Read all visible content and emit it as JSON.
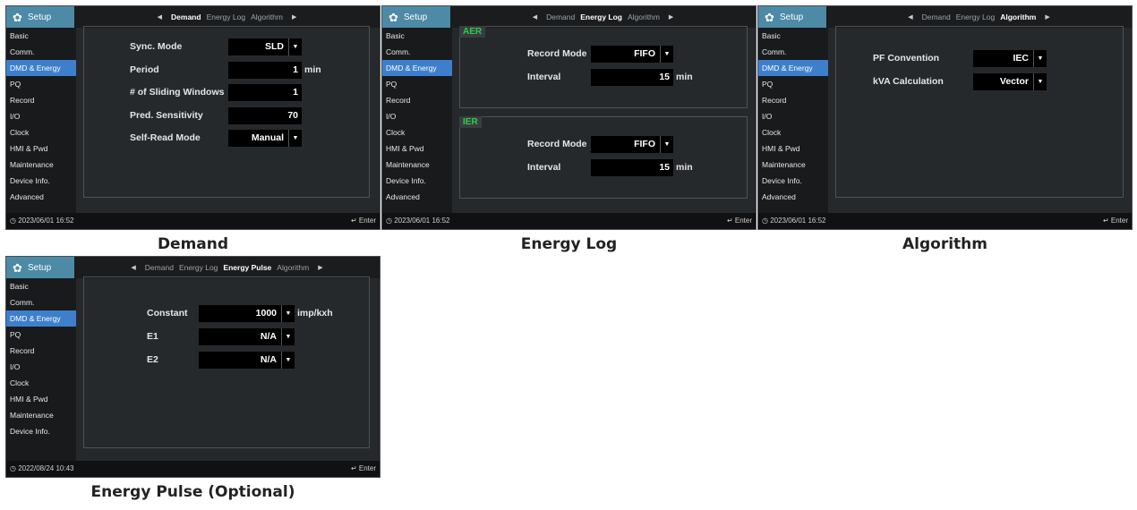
{
  "setup_label": "Setup",
  "sidebar": [
    "Basic",
    "Comm.",
    "DMD & Energy",
    "PQ",
    "Record",
    "I/O",
    "Clock",
    "HMI & Pwd",
    "Maintenance",
    "Device Info.",
    "Advanced"
  ],
  "sidebar_active": "DMD & Energy",
  "enter_label": "Enter",
  "screens": {
    "demand": {
      "tabs": [
        "Demand",
        "Energy Log",
        "Algorithm"
      ],
      "active_tab": "Demand",
      "fields": [
        {
          "label": "Sync. Mode",
          "value": "SLD",
          "dropdown": true,
          "unit": ""
        },
        {
          "label": "Period",
          "value": "1",
          "dropdown": false,
          "unit": "min"
        },
        {
          "label": "# of Sliding Windows",
          "value": "1",
          "dropdown": false,
          "unit": ""
        },
        {
          "label": "Pred. Sensitivity",
          "value": "70",
          "dropdown": false,
          "unit": ""
        },
        {
          "label": "Self-Read Mode",
          "value": "Manual",
          "dropdown": true,
          "unit": ""
        }
      ],
      "timestamp": "2023/06/01 16:52",
      "caption": "Demand"
    },
    "energy_log": {
      "tabs": [
        "Demand",
        "Energy Log",
        "Algorithm"
      ],
      "active_tab": "Energy Log",
      "sections": [
        {
          "tag": "AER",
          "fields": [
            {
              "label": "Record Mode",
              "value": "FIFO",
              "dropdown": true,
              "unit": ""
            },
            {
              "label": "Interval",
              "value": "15",
              "dropdown": false,
              "unit": "min"
            }
          ]
        },
        {
          "tag": "IER",
          "fields": [
            {
              "label": "Record Mode",
              "value": "FIFO",
              "dropdown": true,
              "unit": ""
            },
            {
              "label": "Interval",
              "value": "15",
              "dropdown": false,
              "unit": "min"
            }
          ]
        }
      ],
      "timestamp": "2023/06/01 16:52",
      "caption": "Energy Log"
    },
    "algorithm": {
      "tabs": [
        "Demand",
        "Energy Log",
        "Algorithm"
      ],
      "active_tab": "Algorithm",
      "fields": [
        {
          "label": "PF Convention",
          "value": "IEC",
          "dropdown": true,
          "unit": ""
        },
        {
          "label": "kVA Calculation",
          "value": "Vector",
          "dropdown": true,
          "unit": ""
        }
      ],
      "timestamp": "2023/06/01 16:52",
      "caption": "Algorithm"
    },
    "energy_pulse": {
      "tabs": [
        "Demand",
        "Energy Log",
        "Energy Pulse",
        "Algorithm"
      ],
      "active_tab": "Energy Pulse",
      "sidebar": [
        "Basic",
        "Comm.",
        "DMD & Energy",
        "PQ",
        "Record",
        "I/O",
        "Clock",
        "HMI & Pwd",
        "Maintenance",
        "Device Info."
      ],
      "fields": [
        {
          "label": "Constant",
          "value": "1000",
          "dropdown": true,
          "unit": "imp/kxh"
        },
        {
          "label": "E1",
          "value": "N/A",
          "dropdown": true,
          "unit": ""
        },
        {
          "label": "E2",
          "value": "N/A",
          "dropdown": true,
          "unit": ""
        }
      ],
      "timestamp": "2022/08/24 10:43",
      "caption": "Energy Pulse (Optional)"
    }
  }
}
